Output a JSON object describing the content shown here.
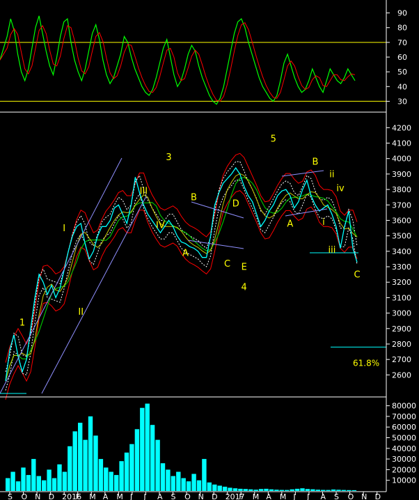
{
  "chart_data": {
    "type": "line",
    "colors": {
      "background": "#000000",
      "axis": "#ffffff",
      "guide": "#ffff00",
      "price": "#00ffff",
      "price_mid": "#ffffff",
      "ma_fast": "#c8c800",
      "ma_slow": "#00c000",
      "envelope": "#ff0000",
      "channel": "#9090ff",
      "rsi": "#00ff00",
      "rsi_signal": "#ff0000",
      "volume": "#00ffff",
      "wave_label": "#ffff00"
    },
    "x_axis": {
      "tick_labels": [
        "S",
        "O",
        "N",
        "D",
        "2016",
        "F",
        "M",
        "A",
        "M",
        "J",
        "J",
        "A",
        "S",
        "O",
        "N",
        "D",
        "2017",
        "F",
        "M",
        "A",
        "M",
        "J",
        "J",
        "A",
        "S",
        "O",
        "N",
        "D"
      ]
    },
    "rsi_panel": {
      "ticks": [
        "90",
        "80",
        "70",
        "60",
        "50",
        "40",
        "30"
      ],
      "ylim": [
        25,
        95
      ],
      "guide_levels": [
        70,
        30
      ],
      "series": [
        {
          "values": [
            58,
            66,
            74,
            86,
            78,
            62,
            50,
            44,
            52,
            66,
            80,
            88,
            76,
            64,
            54,
            48,
            60,
            74,
            84,
            86,
            70,
            58,
            50,
            44,
            52,
            64,
            76,
            82,
            72,
            58,
            48,
            42,
            46,
            54,
            62,
            74,
            70,
            60,
            52,
            46,
            40,
            36,
            34,
            38,
            46,
            56,
            66,
            72,
            60,
            48,
            40,
            44,
            52,
            62,
            68,
            64,
            54,
            46,
            40,
            34,
            30,
            28,
            32,
            40,
            52,
            64,
            76,
            84,
            86,
            80,
            70,
            62,
            54,
            46,
            40,
            36,
            32,
            30,
            34,
            44,
            56,
            62,
            54,
            46,
            40,
            36,
            38,
            44,
            52,
            46,
            40,
            36,
            44,
            52,
            48,
            44,
            42,
            46,
            52,
            48,
            44
          ]
        }
      ]
    },
    "price_panel": {
      "ticks": [
        "4200",
        "4100",
        "4000",
        "3900",
        "3800",
        "3700",
        "3600",
        "3500",
        "3400",
        "3300",
        "3200",
        "3100",
        "3000",
        "2900",
        "2800",
        "2700",
        "2600"
      ],
      "ylim": [
        2480,
        4260
      ],
      "series": [
        {
          "values": [
            2560,
            2760,
            2860,
            2720,
            2620,
            2700,
            2900,
            3100,
            3250,
            3200,
            3120,
            3180,
            3100,
            3160,
            3280,
            3400,
            3500,
            3560,
            3580,
            3450,
            3350,
            3400,
            3500,
            3560,
            3560,
            3600,
            3680,
            3700,
            3640,
            3580,
            3700,
            3880,
            3780,
            3700,
            3640,
            3600,
            3560,
            3520,
            3560,
            3600,
            3560,
            3500,
            3460,
            3450,
            3430,
            3420,
            3400,
            3360,
            3360,
            3500,
            3700,
            3780,
            3840,
            3870,
            3900,
            3940,
            3900,
            3820,
            3760,
            3720,
            3640,
            3560,
            3600,
            3660,
            3700,
            3760,
            3790,
            3800,
            3760,
            3680,
            3720,
            3800,
            3860,
            3760,
            3700,
            3660,
            3680,
            3700,
            3640,
            3560,
            3420,
            3560,
            3660,
            3420,
            3330
          ]
        }
      ],
      "reference_level": 2780,
      "reference_label": "61.8%"
    },
    "volume_panel": {
      "ticks": [
        "80000",
        "70000",
        "60000",
        "50000",
        "40000",
        "30000",
        "20000",
        "10000"
      ],
      "ylim": [
        0,
        85000
      ],
      "values": [
        12000,
        18000,
        9000,
        22000,
        15000,
        30000,
        14000,
        10000,
        20000,
        12000,
        25000,
        18000,
        42000,
        56000,
        64000,
        48000,
        70000,
        52000,
        30000,
        22000,
        18000,
        15000,
        28000,
        36000,
        44000,
        58000,
        78000,
        82000,
        62000,
        48000,
        26000,
        20000,
        14000,
        18000,
        12000,
        9000,
        16000,
        10000,
        30000,
        8000,
        6000,
        5000,
        4000,
        3000,
        2500,
        2000,
        1800,
        1500,
        1200,
        1800,
        2000,
        1500,
        1200,
        1000,
        900,
        1500,
        2000,
        2500,
        1800,
        1600,
        1200,
        1000,
        900,
        1400,
        1100,
        900,
        800,
        700
      ]
    },
    "annotations": [
      {
        "text": "1",
        "x_index": 2,
        "price": 2920
      },
      {
        "text": "I",
        "x_index": 7,
        "price": 3530
      },
      {
        "text": "II",
        "x_index": 9,
        "price": 2990
      },
      {
        "text": "III",
        "x_index": 16,
        "price": 3770
      },
      {
        "text": "3",
        "x_index": 19,
        "price": 3990
      },
      {
        "text": "IV",
        "x_index": 18,
        "price": 3550
      },
      {
        "text": "B",
        "x_index": 22,
        "price": 3730
      },
      {
        "text": "A",
        "x_index": 21,
        "price": 3370
      },
      {
        "text": "D",
        "x_index": 27,
        "price": 3690
      },
      {
        "text": "C",
        "x_index": 26,
        "price": 3300
      },
      {
        "text": "E",
        "x_index": 28,
        "price": 3280
      },
      {
        "text": "4",
        "x_index": 28,
        "price": 3150
      },
      {
        "text": "5",
        "x_index": 31,
        "price": 4110
      },
      {
        "text": "A",
        "x_index": 33,
        "price": 3560
      },
      {
        "text": "B",
        "x_index": 36,
        "price": 3960
      },
      {
        "text": "ii",
        "x_index": 38,
        "price": 3880
      },
      {
        "text": "i",
        "x_index": 37,
        "price": 3570
      },
      {
        "text": "iii",
        "x_index": 38,
        "price": 3390
      },
      {
        "text": "iv",
        "x_index": 39,
        "price": 3790
      },
      {
        "text": "C",
        "x_index": 41,
        "price": 3230
      }
    ]
  }
}
